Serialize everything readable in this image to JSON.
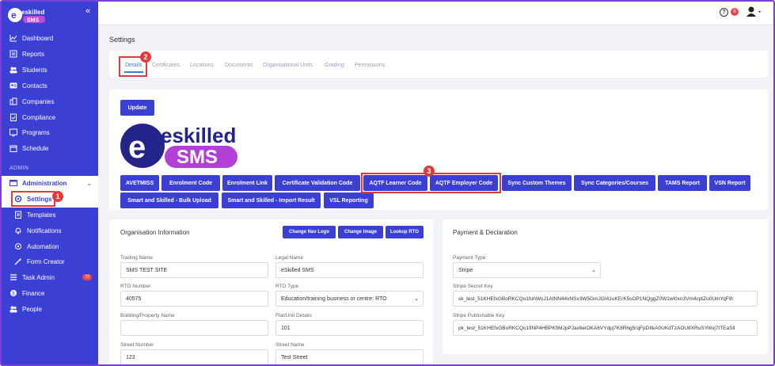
{
  "sidebar": {
    "logo_top": "eskilled",
    "logo_bottom": "SMS",
    "collapse_icon": "«",
    "items": [
      {
        "label": "Dashboard",
        "icon": "dashboard-icon"
      },
      {
        "label": "Reports",
        "icon": "reports-icon"
      },
      {
        "label": "Students",
        "icon": "students-icon"
      },
      {
        "label": "Contacts",
        "icon": "contacts-icon"
      },
      {
        "label": "Companies",
        "icon": "companies-icon"
      },
      {
        "label": "Compliance",
        "icon": "compliance-icon"
      },
      {
        "label": "Programs",
        "icon": "programs-icon"
      },
      {
        "label": "Schedule",
        "icon": "schedule-icon"
      }
    ],
    "admin_label": "ADMIN",
    "administration": "Administration",
    "settings": "Settings",
    "sub_items": [
      {
        "label": "Templates"
      },
      {
        "label": "Notifications"
      },
      {
        "label": "Automation"
      },
      {
        "label": "Form Creator"
      }
    ],
    "bottom_items": [
      {
        "label": "Task Admin",
        "badge": "72"
      },
      {
        "label": "Finance"
      },
      {
        "label": "People"
      }
    ]
  },
  "topbar": {
    "help_icon": "?",
    "notif_count": "6"
  },
  "page": {
    "title": "Settings",
    "tabs": [
      "Details",
      "Certificates",
      "Locations",
      "Documents",
      "Organisational Units",
      "Grading",
      "Permissions"
    ],
    "update_button": "Update",
    "logo_top": "eskilled",
    "logo_bottom": "SMS",
    "action_buttons_row1": [
      "AVETMISS",
      "Enrolment Code",
      "Enrolment Link",
      "Certificate Validation Code",
      "AQTF Learner Code",
      "AQTF Employer Code",
      "Sync Custom Themes",
      "Sync Categories/Courses",
      "TAMS Report",
      "VSN Report"
    ],
    "action_buttons_row2": [
      "Smart and Skilled - Bulk Upload",
      "Smart and Skilled - Import Result",
      "VSL Reporting"
    ]
  },
  "annotations": [
    "1",
    "2",
    "3"
  ],
  "org": {
    "title": "Organisation Information",
    "btn_nav_logo": "Change Nav Logo",
    "btn_image": "Change Image",
    "btn_lookup": "Lookup RTO",
    "trading_name_label": "Trading Name",
    "trading_name": "SMS TEST SITE",
    "legal_name_label": "Legal Name",
    "legal_name": "eSkilled SMS",
    "rto_number_label": "RTO Number",
    "rto_number": "40575",
    "rto_type_label": "RTO Type",
    "rto_type": "Education/training business or centre: RTO",
    "building_label": "Building/Property Name",
    "building": "",
    "flat_label": "Flat/Unit Details",
    "flat": "101",
    "street_number_label": "Street Number",
    "street_number": "123",
    "street_name_label": "Street Name",
    "street_name": "Test Street"
  },
  "payment": {
    "title": "Payment & Declaration",
    "type_label": "Payment Type",
    "type": "Stripe",
    "secret_label": "Stripe Secret Key",
    "secret": "sk_test_51KHEfxGBoRKCQo1fuhWoJ1AtNN44xNSv3W5GmJGI41uKErK5sOP1NQggZ0W1wl0xn3Vm4cptZo0UmYqF9\\",
    "pub_label": "Stripe Publishable Key",
    "pub": "pk_test_51KHEfxGBoRKCQo1fiNP4HBPKfiMJpPJax6eiOKA6VYdpj7K8Rhg5rqFpDIIkA0UKdTzAOU8XRuSYl6vj7tTEaSll"
  }
}
